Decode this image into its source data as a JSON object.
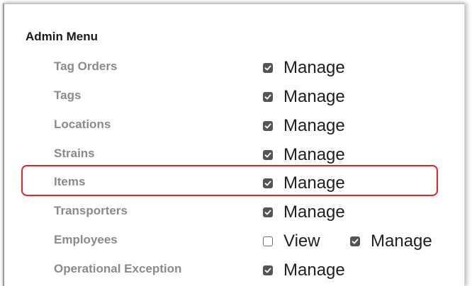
{
  "panel": {
    "title": "Admin Menu"
  },
  "rows": [
    {
      "label": "Tag Orders",
      "options": [
        {
          "label": "Manage",
          "checked": true
        }
      ]
    },
    {
      "label": "Tags",
      "options": [
        {
          "label": "Manage",
          "checked": true
        }
      ]
    },
    {
      "label": "Locations",
      "options": [
        {
          "label": "Manage",
          "checked": true
        }
      ]
    },
    {
      "label": "Strains",
      "options": [
        {
          "label": "Manage",
          "checked": true
        }
      ]
    },
    {
      "label": "Items",
      "options": [
        {
          "label": "Manage",
          "checked": true
        }
      ]
    },
    {
      "label": "Transporters",
      "options": [
        {
          "label": "Manage",
          "checked": true
        }
      ]
    },
    {
      "label": "Employees",
      "options": [
        {
          "label": "View",
          "checked": false
        },
        {
          "label": "Manage",
          "checked": true
        }
      ]
    },
    {
      "label": "Operational Exception",
      "options": [
        {
          "label": "Manage",
          "checked": true
        }
      ]
    }
  ],
  "highlight": {
    "row_label": "Items",
    "color": "#e32126"
  },
  "colors": {
    "row_label": "#8a8a8a",
    "checkbox_checked": "#555555"
  }
}
